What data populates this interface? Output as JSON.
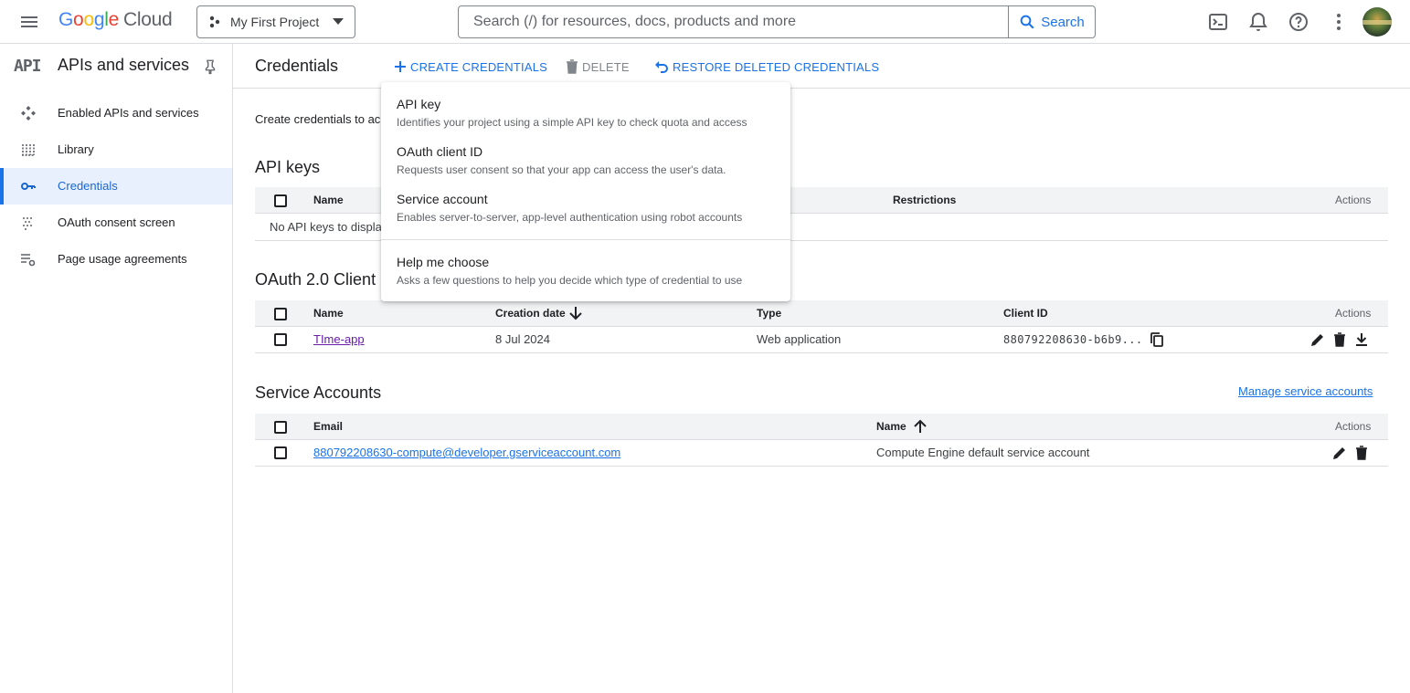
{
  "topbar": {
    "logo": [
      "G",
      "o",
      "o",
      "g",
      "l",
      "e"
    ],
    "logo_product": "Cloud",
    "project": "My First Project",
    "search_placeholder": "Search (/) for resources, docs, products and more",
    "search_button": "Search"
  },
  "sidebar": {
    "logo_text": "API",
    "title": "APIs and services",
    "items": [
      {
        "label": "Enabled APIs and services",
        "icon": "enabled-apis-icon"
      },
      {
        "label": "Library",
        "icon": "library-icon"
      },
      {
        "label": "Credentials",
        "icon": "key-icon",
        "active": true
      },
      {
        "label": "OAuth consent screen",
        "icon": "consent-icon"
      },
      {
        "label": "Page usage agreements",
        "icon": "settings-list-icon"
      }
    ]
  },
  "header": {
    "title": "Credentials",
    "create_label": "CREATE CREDENTIALS",
    "delete_label": "DELETE",
    "restore_label": "RESTORE DELETED CREDENTIALS"
  },
  "content": {
    "intro": "Create credentials to ac",
    "api_keys": {
      "title": "API keys",
      "columns": [
        "Name",
        "Restrictions",
        "Actions"
      ],
      "empty_text": "No API keys to displa"
    },
    "oauth": {
      "title": "OAuth 2.0 Client I",
      "columns": [
        "Name",
        "Creation date",
        "Type",
        "Client ID",
        "Actions"
      ],
      "rows": [
        {
          "name": "TIme-app",
          "created": "8 Jul 2024",
          "type": "Web application",
          "client_id": "880792208630-b6b9..."
        }
      ]
    },
    "service_accounts": {
      "title": "Service Accounts",
      "manage_link": "Manage service accounts",
      "columns": [
        "Email",
        "Name",
        "Actions"
      ],
      "rows": [
        {
          "email": "880792208630-compute@developer.gserviceaccount.com",
          "name": "Compute Engine default service account"
        }
      ]
    }
  },
  "dropdown": {
    "items": [
      {
        "title": "API key",
        "desc": "Identifies your project using a simple API key to check quota and access"
      },
      {
        "title": "OAuth client ID",
        "desc": "Requests user consent so that your app can access the user's data."
      },
      {
        "title": "Service account",
        "desc": "Enables server-to-server, app-level authentication using robot accounts"
      },
      {
        "title": "Help me choose",
        "desc": "Asks a few questions to help you decide which type of credential to use"
      }
    ]
  },
  "colors": {
    "accent": "#1a73e8",
    "active_bg": "#e8f0fe",
    "visited_link": "#681da8"
  }
}
